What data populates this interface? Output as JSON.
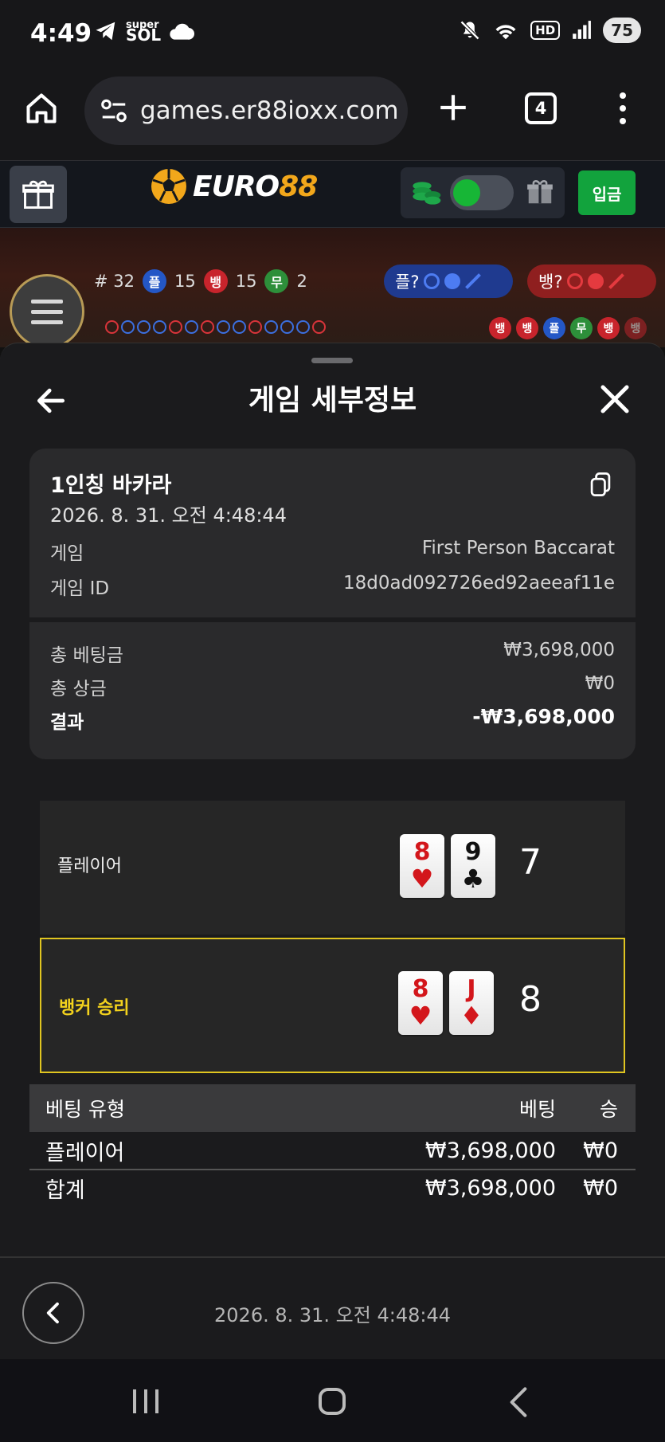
{
  "status_bar": {
    "time": "4:49",
    "super_sol": "super SOL",
    "hd": "HD",
    "battery": "75",
    "left_icons": [
      "telegram-icon",
      "supersol-icon",
      "cloud-icon"
    ],
    "right_icons": [
      "mute-icon",
      "wifi-icon",
      "hd-icon",
      "signal-icon",
      "battery-icon"
    ]
  },
  "browser": {
    "url": "games.er88ioxx.com",
    "tab_count": "4"
  },
  "site_header": {
    "logo_text": "EURO",
    "logo_num": "88",
    "deposit_label": "입금",
    "accent_green": "#12a33d",
    "brand_orange": "#f2a71b"
  },
  "game_strip": {
    "round": "# 32",
    "player_chip": "플",
    "player_count": "15",
    "banker_chip": "뱅",
    "banker_count": "15",
    "tie_chip": "무",
    "tie_count": "2",
    "predict_player": "플?",
    "predict_banker": "뱅?",
    "recent_results": [
      "뱅",
      "뱅",
      "플",
      "무",
      "뱅",
      "뱅"
    ]
  },
  "modal": {
    "title": "게임 세부정보",
    "game_name": "1인칭 바카라",
    "game_date": "2026. 8. 31. 오전 4:48:44",
    "game_label": "게임",
    "game_value": "First Person Baccarat",
    "game_id_label": "게임 ID",
    "game_id_value": "18d0ad092726ed92aeeaf11e",
    "total_bet_label": "총 베팅금",
    "total_bet_value": "₩3,698,000",
    "total_win_label": "총 상금",
    "total_win_value": "₩0",
    "result_label": "결과",
    "result_value": "-₩3,698,000",
    "player_hand": {
      "label": "플레이어",
      "cards": [
        {
          "rank": "8",
          "suit": "♥"
        },
        {
          "rank": "9",
          "suit": "♣"
        }
      ],
      "total": "7"
    },
    "banker_hand": {
      "label": "뱅커 승리",
      "cards": [
        {
          "rank": "8",
          "suit": "♥"
        },
        {
          "rank": "J",
          "suit": "♦"
        }
      ],
      "total": "8",
      "highlight_color": "#e0c520"
    },
    "bet_table": {
      "headers": [
        "베팅 유형",
        "베팅",
        "승"
      ],
      "rows": [
        [
          "플레이어",
          "₩3,698,000",
          "₩0"
        ]
      ],
      "total": [
        "합계",
        "₩3,698,000",
        "₩0"
      ]
    },
    "footer_date": "2026. 8. 31. 오전 4:48:44"
  }
}
